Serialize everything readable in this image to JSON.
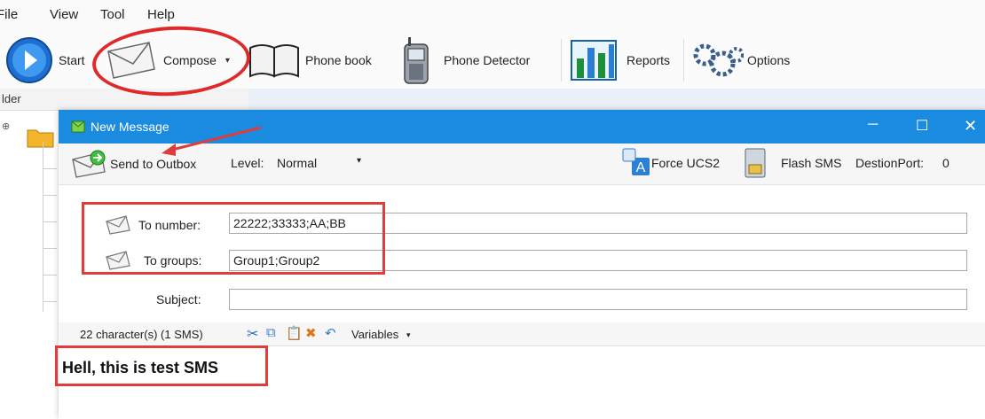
{
  "menu": {
    "file": "File",
    "view": "View",
    "tool": "Tool",
    "help": "Help"
  },
  "toolbar": {
    "start": "Start",
    "compose": "Compose",
    "phonebook": "Phone book",
    "phone_detector": "Phone Detector",
    "reports": "Reports",
    "options": "Options"
  },
  "leftpane": {
    "header": "lder"
  },
  "dialog": {
    "title": "New Message",
    "send_to_outbox": "Send to Outbox",
    "level_label": "Level:",
    "level_value": "Normal",
    "force_ucs2": "Force UCS2",
    "flash_sms": "Flash SMS",
    "destion_port_label": "DestionPort:",
    "destion_port_value": "0",
    "to_number_label": "To number:",
    "to_number_value": "22222;33333;AA;BB",
    "to_groups_label": "To groups:",
    "to_groups_value": "Group1;Group2",
    "subject_label": "Subject:",
    "subject_value": "",
    "char_count": "22 character(s) (1 SMS)",
    "variables": "Variables",
    "message_body": "Hell, this is test SMS"
  },
  "colors": {
    "titlebar": "#1b8be0",
    "annotation_red": "#e03c3c"
  }
}
